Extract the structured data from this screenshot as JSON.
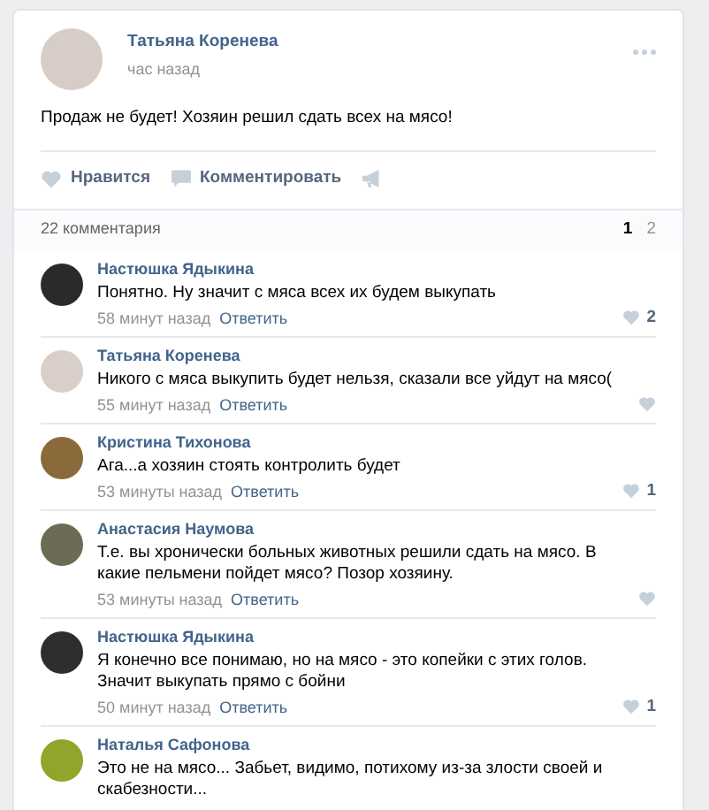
{
  "post": {
    "author": "Татьяна Коренева",
    "time": "час назад",
    "text": "Продаж не будет! Хозяин решил сдать всех на мясо!",
    "actions": [
      "Нравится",
      "Комментировать"
    ]
  },
  "comments_header": {
    "count": "22 комментария",
    "pages": [
      {
        "label": "1",
        "selected": true
      },
      {
        "label": "2",
        "selected": false
      }
    ]
  },
  "comments": [
    {
      "author": "Настюшка Ядыкина",
      "text": "Понятно. Ну значит с мяса всех их будем выкупать",
      "time": "58 минут назад",
      "reply": "Ответить",
      "likes": "2"
    },
    {
      "author": "Татьяна Коренева",
      "text": "Никого с мяса выкупить будет нельзя, сказали все уйдут на мясо(",
      "time": "55 минут назад",
      "reply": "Ответить"
    },
    {
      "author": "Кристина Тихонова",
      "text": "Ага...а хозяин стоять контролить будет",
      "time": "53 минуты назад",
      "reply": "Ответить",
      "likes": "1"
    },
    {
      "author": "Анастасия Наумова",
      "text": "Т.е. вы хронически больных животных решили сдать на мясо. В какие пельмени пойдет мясо? Позор хозяину.",
      "time": "53 минуты назад",
      "reply": "Ответить"
    },
    {
      "author": "Настюшка Ядыкина",
      "text": "Я конечно все понимаю, но на мясо - это копейки с этих голов. Значит выкупать прямо с бойни",
      "time": "50 минут назад",
      "reply": "Ответить",
      "likes": "1"
    },
    {
      "author": "Наталья Сафонова",
      "text": "Это не на мясо... Забьет, видимо, потихому из-за злости своей и скабезности..."
    }
  ]
}
